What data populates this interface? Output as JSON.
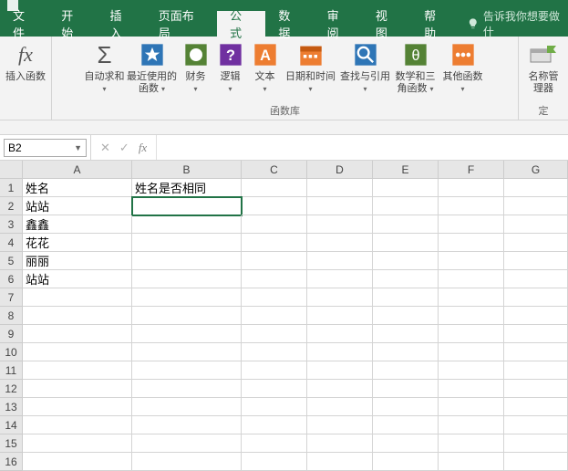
{
  "tabs": {
    "file": "文件",
    "home": "开始",
    "insert": "插入",
    "pagelayout": "页面布局",
    "formulas": "公式",
    "data": "数据",
    "review": "审阅",
    "view": "视图",
    "help": "帮助"
  },
  "tellme": "告诉我你想要做什",
  "ribbon": {
    "insert_fn": "插入函数",
    "autosum": "自动求和",
    "recent": "最近使用的函数",
    "financial": "财务",
    "logical": "逻辑",
    "text": "文本",
    "datetime": "日期和时间",
    "lookup": "查找与引用",
    "math": "数学和三角函数",
    "other": "其他函数",
    "name_mgr": "名称管理器",
    "group_funclib": "函数库",
    "group_defname": "定"
  },
  "namebox": "B2",
  "fx_label": "fx",
  "columns": [
    "A",
    "B",
    "C",
    "D",
    "E",
    "F",
    "G"
  ],
  "rows": [
    "1",
    "2",
    "3",
    "4",
    "5",
    "6",
    "7",
    "8",
    "9",
    "10",
    "11",
    "12",
    "13",
    "14",
    "15",
    "16"
  ],
  "cells": {
    "A1": "姓名",
    "B1": "姓名是否相同",
    "A2": "站站",
    "A3": "鑫鑫",
    "A4": "花花",
    "A5": "丽丽",
    "A6": "站站"
  },
  "selected_cell": "B2"
}
